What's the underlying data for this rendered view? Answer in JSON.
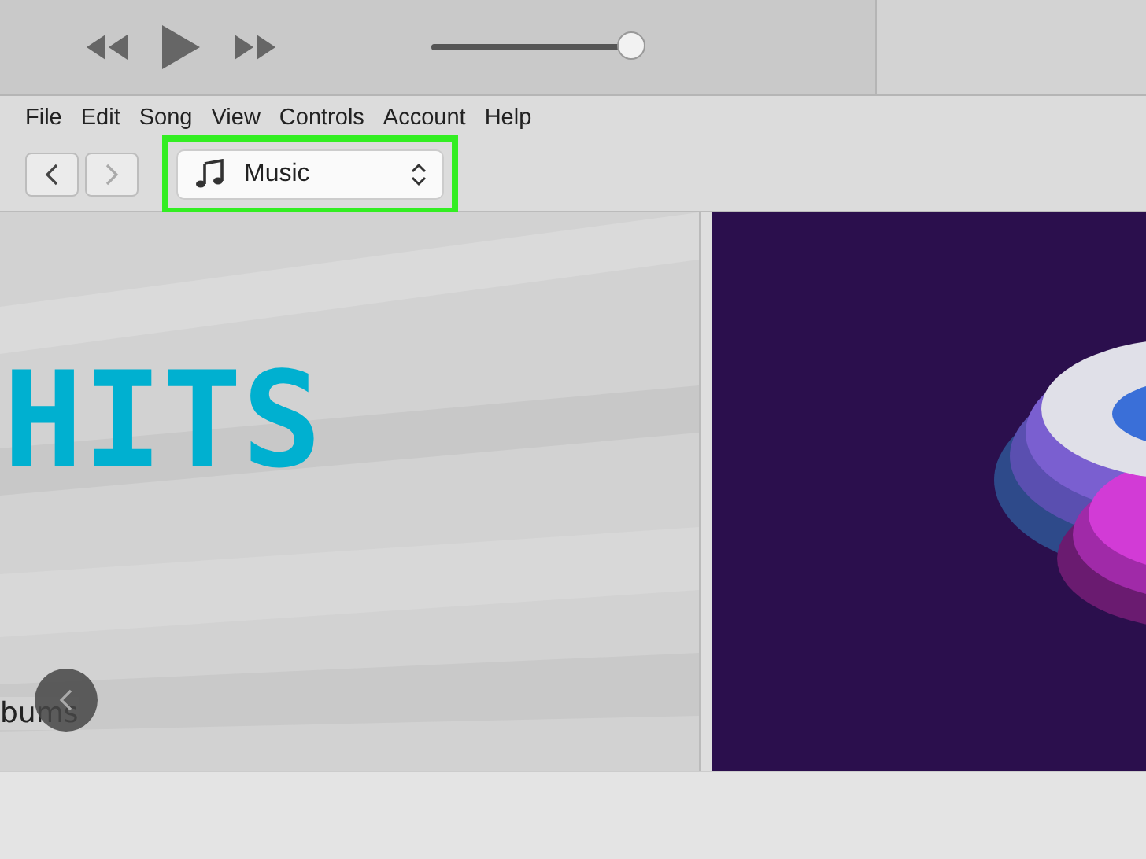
{
  "player": {
    "volume": {
      "level": 0.98
    }
  },
  "menu": [
    "File",
    "Edit",
    "Song",
    "View",
    "Controls",
    "Account",
    "Help"
  ],
  "nav": {
    "back": {
      "disabled": false
    },
    "forward": {
      "disabled": true
    }
  },
  "library_picker": {
    "label": "Music",
    "highlighted": true
  },
  "featured": [
    {
      "kind": "banner",
      "title": "HITS",
      "caption": "bums"
    },
    {
      "kind": "picture"
    }
  ]
}
